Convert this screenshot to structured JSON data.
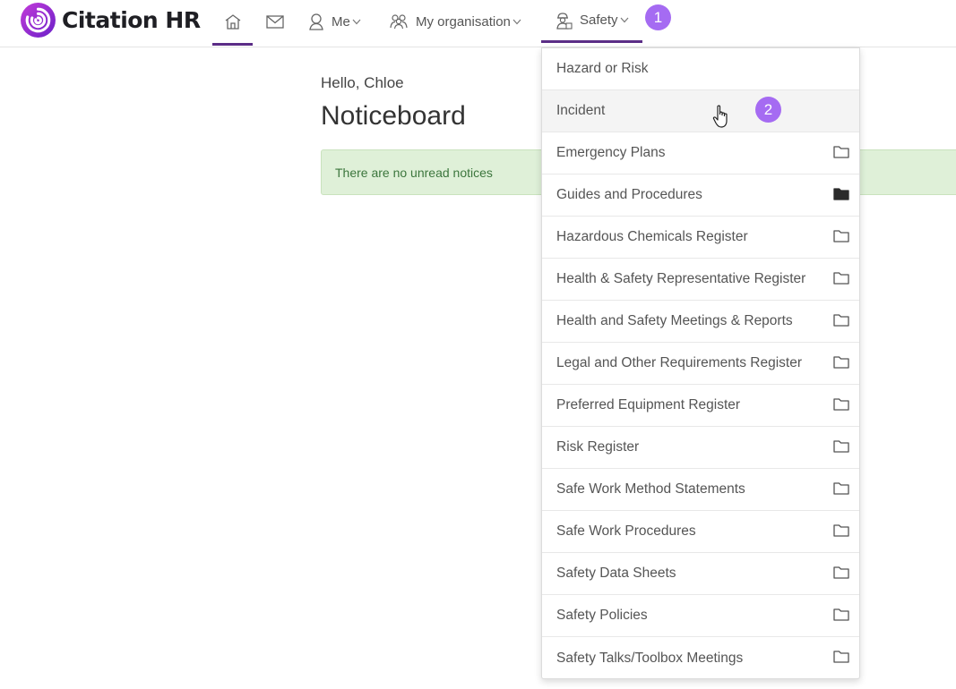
{
  "app": {
    "name": "Citation HR"
  },
  "nav": {
    "me_label": "Me",
    "org_label": "My organisation",
    "safety_label": "Safety"
  },
  "badges": {
    "one": "1",
    "two": "2"
  },
  "main": {
    "greeting": "Hello, Chloe",
    "title": "Noticeboard",
    "notice": "There are no unread notices"
  },
  "safety_menu": {
    "items": [
      {
        "label": "Hazard or Risk",
        "folder": "none"
      },
      {
        "label": "Incident",
        "folder": "none"
      },
      {
        "label": "Emergency Plans",
        "folder": "outline"
      },
      {
        "label": "Guides and Procedures",
        "folder": "filled"
      },
      {
        "label": "Hazardous Chemicals Register",
        "folder": "outline"
      },
      {
        "label": "Health & Safety Representative Register",
        "folder": "outline"
      },
      {
        "label": "Health and Safety Meetings & Reports",
        "folder": "outline"
      },
      {
        "label": "Legal and Other Requirements Register",
        "folder": "outline"
      },
      {
        "label": "Preferred Equipment Register",
        "folder": "outline"
      },
      {
        "label": "Risk Register",
        "folder": "outline"
      },
      {
        "label": "Safe Work Method Statements",
        "folder": "outline"
      },
      {
        "label": "Safe Work Procedures",
        "folder": "outline"
      },
      {
        "label": "Safety Data Sheets",
        "folder": "outline"
      },
      {
        "label": "Safety Policies",
        "folder": "outline"
      },
      {
        "label": "Safety Talks/Toolbox Meetings",
        "folder": "outline"
      }
    ]
  },
  "colors": {
    "brand": "#5b2d86",
    "badge": "#a56bf2",
    "notice_bg": "#dff0d8",
    "notice_text": "#3c763d"
  }
}
